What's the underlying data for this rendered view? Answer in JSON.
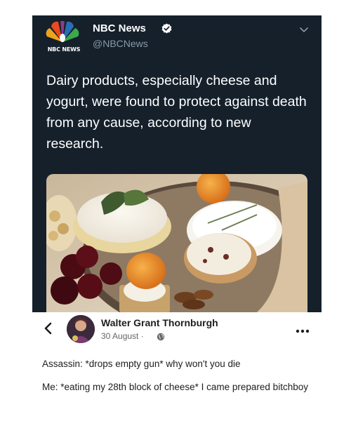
{
  "tweet": {
    "account_name": "NBC News",
    "handle": "@NBCNews",
    "logo_caption": "NBC NEWS",
    "text": "Dairy products, especially cheese and yogurt, were found to protect against death from any cause, according to new research.",
    "colors": {
      "background": "#15202b",
      "text": "#ffffff",
      "handle": "#8899a6",
      "verified": "#ffffff"
    },
    "icons": {
      "verified": "verified-badge-icon",
      "menu": "chevron-down-icon",
      "logo": "nbc-peacock-logo"
    },
    "photo": {
      "subject": "cheese board photo"
    }
  },
  "comment": {
    "author": "Walter Grant Thornburgh",
    "date": "30 August · ",
    "lines": [
      "Assassin: *drops empty gun* why won't you die",
      "Me: *eating my 28th block of cheese* I came prepared bitchboy"
    ],
    "icons": {
      "back": "chevron-left-icon",
      "privacy": "globe-icon",
      "more": "more-options-icon"
    }
  }
}
